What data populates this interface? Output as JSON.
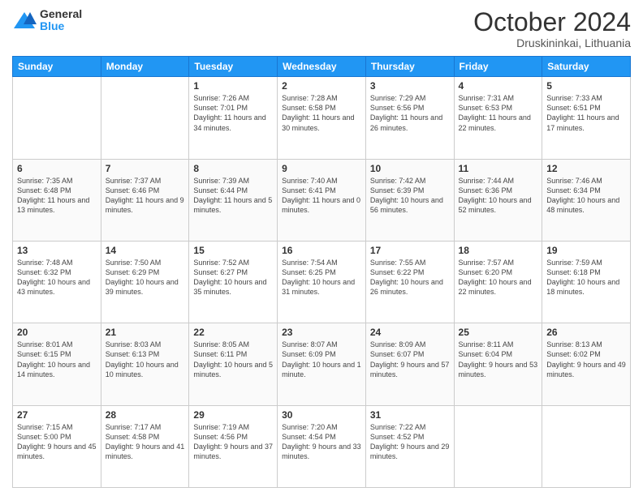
{
  "header": {
    "logo_general": "General",
    "logo_blue": "Blue",
    "month_title": "October 2024",
    "location": "Druskininkai, Lithuania"
  },
  "weekdays": [
    "Sunday",
    "Monday",
    "Tuesday",
    "Wednesday",
    "Thursday",
    "Friday",
    "Saturday"
  ],
  "weeks": [
    [
      {
        "day": "",
        "sunrise": "",
        "sunset": "",
        "daylight": ""
      },
      {
        "day": "",
        "sunrise": "",
        "sunset": "",
        "daylight": ""
      },
      {
        "day": "1",
        "sunrise": "Sunrise: 7:26 AM",
        "sunset": "Sunset: 7:01 PM",
        "daylight": "Daylight: 11 hours and 34 minutes."
      },
      {
        "day": "2",
        "sunrise": "Sunrise: 7:28 AM",
        "sunset": "Sunset: 6:58 PM",
        "daylight": "Daylight: 11 hours and 30 minutes."
      },
      {
        "day": "3",
        "sunrise": "Sunrise: 7:29 AM",
        "sunset": "Sunset: 6:56 PM",
        "daylight": "Daylight: 11 hours and 26 minutes."
      },
      {
        "day": "4",
        "sunrise": "Sunrise: 7:31 AM",
        "sunset": "Sunset: 6:53 PM",
        "daylight": "Daylight: 11 hours and 22 minutes."
      },
      {
        "day": "5",
        "sunrise": "Sunrise: 7:33 AM",
        "sunset": "Sunset: 6:51 PM",
        "daylight": "Daylight: 11 hours and 17 minutes."
      }
    ],
    [
      {
        "day": "6",
        "sunrise": "Sunrise: 7:35 AM",
        "sunset": "Sunset: 6:48 PM",
        "daylight": "Daylight: 11 hours and 13 minutes."
      },
      {
        "day": "7",
        "sunrise": "Sunrise: 7:37 AM",
        "sunset": "Sunset: 6:46 PM",
        "daylight": "Daylight: 11 hours and 9 minutes."
      },
      {
        "day": "8",
        "sunrise": "Sunrise: 7:39 AM",
        "sunset": "Sunset: 6:44 PM",
        "daylight": "Daylight: 11 hours and 5 minutes."
      },
      {
        "day": "9",
        "sunrise": "Sunrise: 7:40 AM",
        "sunset": "Sunset: 6:41 PM",
        "daylight": "Daylight: 11 hours and 0 minutes."
      },
      {
        "day": "10",
        "sunrise": "Sunrise: 7:42 AM",
        "sunset": "Sunset: 6:39 PM",
        "daylight": "Daylight: 10 hours and 56 minutes."
      },
      {
        "day": "11",
        "sunrise": "Sunrise: 7:44 AM",
        "sunset": "Sunset: 6:36 PM",
        "daylight": "Daylight: 10 hours and 52 minutes."
      },
      {
        "day": "12",
        "sunrise": "Sunrise: 7:46 AM",
        "sunset": "Sunset: 6:34 PM",
        "daylight": "Daylight: 10 hours and 48 minutes."
      }
    ],
    [
      {
        "day": "13",
        "sunrise": "Sunrise: 7:48 AM",
        "sunset": "Sunset: 6:32 PM",
        "daylight": "Daylight: 10 hours and 43 minutes."
      },
      {
        "day": "14",
        "sunrise": "Sunrise: 7:50 AM",
        "sunset": "Sunset: 6:29 PM",
        "daylight": "Daylight: 10 hours and 39 minutes."
      },
      {
        "day": "15",
        "sunrise": "Sunrise: 7:52 AM",
        "sunset": "Sunset: 6:27 PM",
        "daylight": "Daylight: 10 hours and 35 minutes."
      },
      {
        "day": "16",
        "sunrise": "Sunrise: 7:54 AM",
        "sunset": "Sunset: 6:25 PM",
        "daylight": "Daylight: 10 hours and 31 minutes."
      },
      {
        "day": "17",
        "sunrise": "Sunrise: 7:55 AM",
        "sunset": "Sunset: 6:22 PM",
        "daylight": "Daylight: 10 hours and 26 minutes."
      },
      {
        "day": "18",
        "sunrise": "Sunrise: 7:57 AM",
        "sunset": "Sunset: 6:20 PM",
        "daylight": "Daylight: 10 hours and 22 minutes."
      },
      {
        "day": "19",
        "sunrise": "Sunrise: 7:59 AM",
        "sunset": "Sunset: 6:18 PM",
        "daylight": "Daylight: 10 hours and 18 minutes."
      }
    ],
    [
      {
        "day": "20",
        "sunrise": "Sunrise: 8:01 AM",
        "sunset": "Sunset: 6:15 PM",
        "daylight": "Daylight: 10 hours and 14 minutes."
      },
      {
        "day": "21",
        "sunrise": "Sunrise: 8:03 AM",
        "sunset": "Sunset: 6:13 PM",
        "daylight": "Daylight: 10 hours and 10 minutes."
      },
      {
        "day": "22",
        "sunrise": "Sunrise: 8:05 AM",
        "sunset": "Sunset: 6:11 PM",
        "daylight": "Daylight: 10 hours and 5 minutes."
      },
      {
        "day": "23",
        "sunrise": "Sunrise: 8:07 AM",
        "sunset": "Sunset: 6:09 PM",
        "daylight": "Daylight: 10 hours and 1 minute."
      },
      {
        "day": "24",
        "sunrise": "Sunrise: 8:09 AM",
        "sunset": "Sunset: 6:07 PM",
        "daylight": "Daylight: 9 hours and 57 minutes."
      },
      {
        "day": "25",
        "sunrise": "Sunrise: 8:11 AM",
        "sunset": "Sunset: 6:04 PM",
        "daylight": "Daylight: 9 hours and 53 minutes."
      },
      {
        "day": "26",
        "sunrise": "Sunrise: 8:13 AM",
        "sunset": "Sunset: 6:02 PM",
        "daylight": "Daylight: 9 hours and 49 minutes."
      }
    ],
    [
      {
        "day": "27",
        "sunrise": "Sunrise: 7:15 AM",
        "sunset": "Sunset: 5:00 PM",
        "daylight": "Daylight: 9 hours and 45 minutes."
      },
      {
        "day": "28",
        "sunrise": "Sunrise: 7:17 AM",
        "sunset": "Sunset: 4:58 PM",
        "daylight": "Daylight: 9 hours and 41 minutes."
      },
      {
        "day": "29",
        "sunrise": "Sunrise: 7:19 AM",
        "sunset": "Sunset: 4:56 PM",
        "daylight": "Daylight: 9 hours and 37 minutes."
      },
      {
        "day": "30",
        "sunrise": "Sunrise: 7:20 AM",
        "sunset": "Sunset: 4:54 PM",
        "daylight": "Daylight: 9 hours and 33 minutes."
      },
      {
        "day": "31",
        "sunrise": "Sunrise: 7:22 AM",
        "sunset": "Sunset: 4:52 PM",
        "daylight": "Daylight: 9 hours and 29 minutes."
      },
      {
        "day": "",
        "sunrise": "",
        "sunset": "",
        "daylight": ""
      },
      {
        "day": "",
        "sunrise": "",
        "sunset": "",
        "daylight": ""
      }
    ]
  ]
}
